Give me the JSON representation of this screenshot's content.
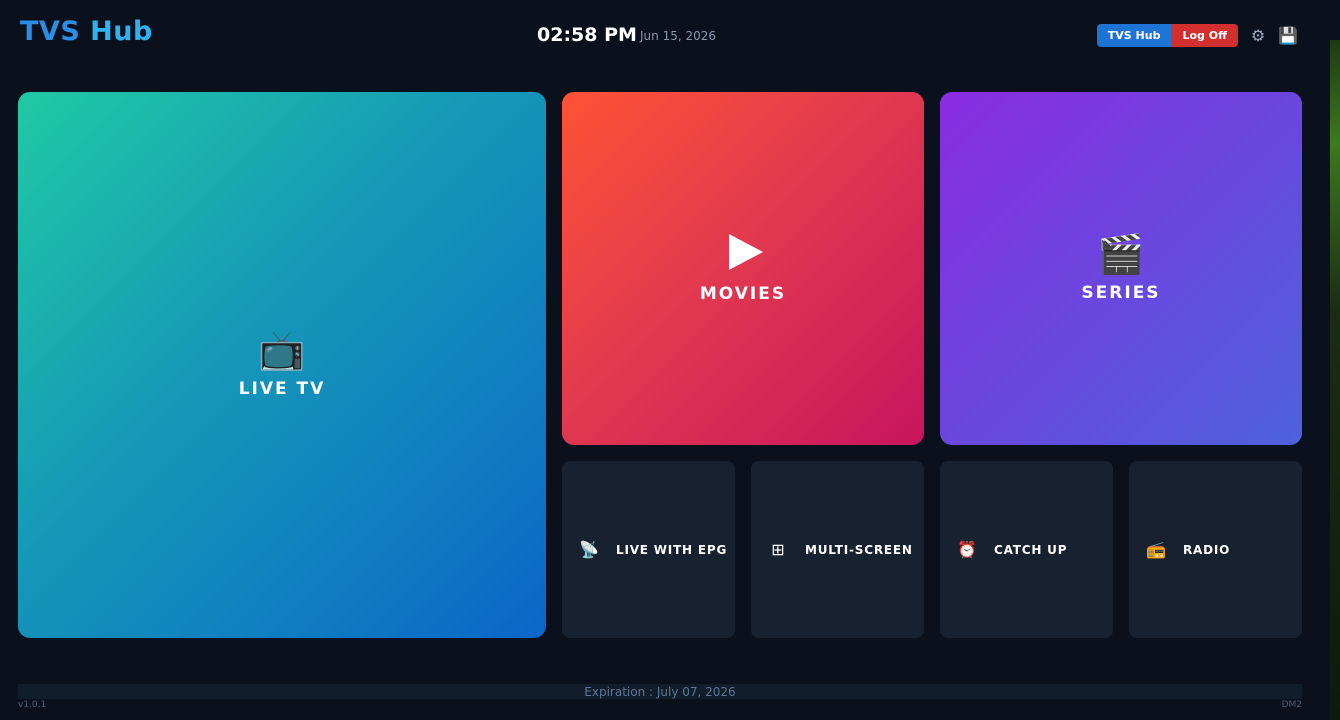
{
  "header": {
    "logo_prefix": "TVS ",
    "logo_suffix": "Hub",
    "time": "02:58 PM",
    "date": "Jun 15, 2026",
    "profile_button": "TVS Hub",
    "logoff_button": "Log Off",
    "settings_icon": "⚙",
    "save_icon": "💾"
  },
  "tiles": {
    "live_tv": {
      "icon": "📺",
      "label": "LIVE TV"
    },
    "movies": {
      "icon": "play-icon",
      "label": "MOVIES"
    },
    "series": {
      "icon": "🎬",
      "label": "SERIES"
    }
  },
  "mini_tiles": [
    {
      "icon": "📡",
      "label": "LIVE WITH EPG"
    },
    {
      "icon": "⊞",
      "label": "MULTI-SCREEN"
    },
    {
      "icon": "⏰",
      "label": "CATCH UP"
    },
    {
      "icon": "📻",
      "label": "RADIO"
    }
  ],
  "footer": {
    "expiration": "Expiration :  July 07, 2026",
    "version": "v1.0.1",
    "build": "DM2"
  },
  "colors": {
    "background": "#0b111c",
    "logo_blue": "#2a8ee6",
    "profile_blue": "#1d73d6",
    "logoff_red": "#d32f2f",
    "mini_tile": "#18212f"
  }
}
